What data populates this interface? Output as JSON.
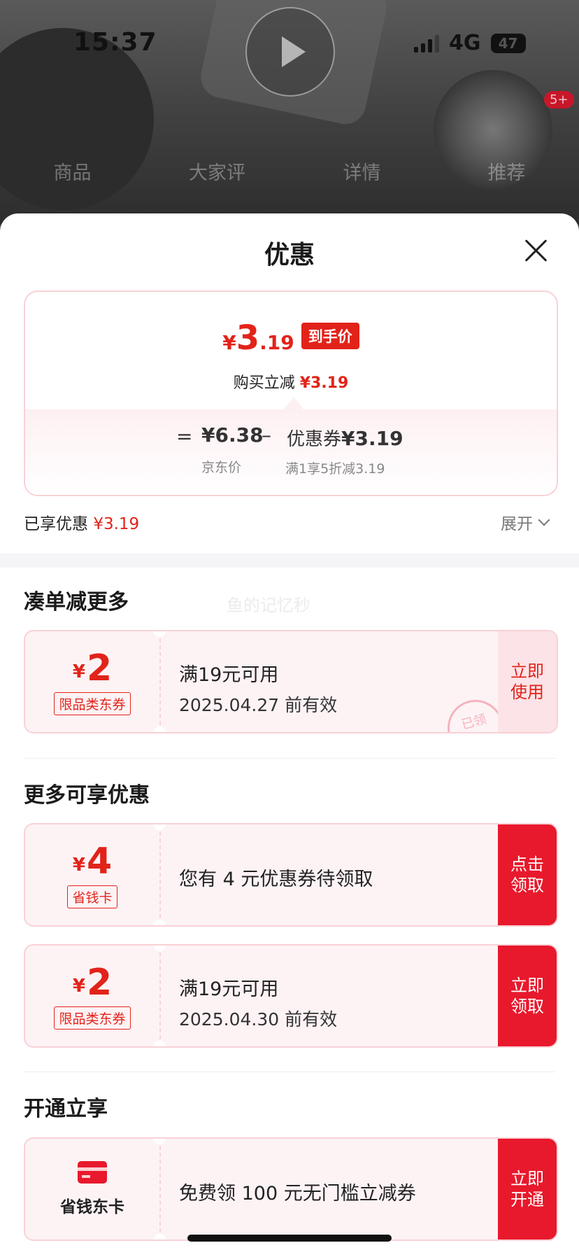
{
  "status_bar": {
    "time": "15:37",
    "network": "4G",
    "battery": "47"
  },
  "hero": {
    "badge": "5+"
  },
  "top_tabs": [
    "商品",
    "大家评",
    "详情",
    "推荐"
  ],
  "sheet": {
    "title": "优惠"
  },
  "summary": {
    "yen": "¥",
    "price_int": "3",
    "price_dec": ".19",
    "price_tag": "到手价",
    "buy_reduce_label": "购买立减",
    "buy_reduce_value": "¥3.19",
    "eq": "=",
    "jd_price": "¥6.38",
    "minus": "–",
    "coupon_label": "优惠券",
    "coupon_value": "¥3.19",
    "jd_price_label": "京东价",
    "coupon_note": "满1享5折减3.19"
  },
  "enjoyed": {
    "label": "已享优惠",
    "value": "¥3.19",
    "expand": "展开"
  },
  "section1": {
    "title": "凑单减更多",
    "watermark": "鱼的记忆秒"
  },
  "coupon1": {
    "yen": "¥",
    "amount": "2",
    "kind": "限品类东券",
    "line1": "满19元可用",
    "line2": "2025.04.27 前有效",
    "action": "立即\n使用",
    "stamp": "已领"
  },
  "section2": {
    "title": "更多可享优惠"
  },
  "coupon2": {
    "yen": "¥",
    "amount": "4",
    "kind": "省钱卡",
    "line1": "您有 4 元优惠券待领取",
    "action": "点击\n领取"
  },
  "coupon3": {
    "yen": "¥",
    "amount": "2",
    "kind": "限品类东券",
    "line1": "满19元可用",
    "line2": "2025.04.30 前有效",
    "action": "立即\n领取"
  },
  "section3": {
    "title": "开通立享"
  },
  "coupon4": {
    "name": "省钱东卡",
    "line1": "免费领 100 元无门槛立减券",
    "action": "立即\n开通"
  },
  "colors": {
    "accent": "#e2231a",
    "action_red": "#e8192c",
    "coupon_bg": "#fdf3f5",
    "border_pink": "#f8d1d6"
  }
}
